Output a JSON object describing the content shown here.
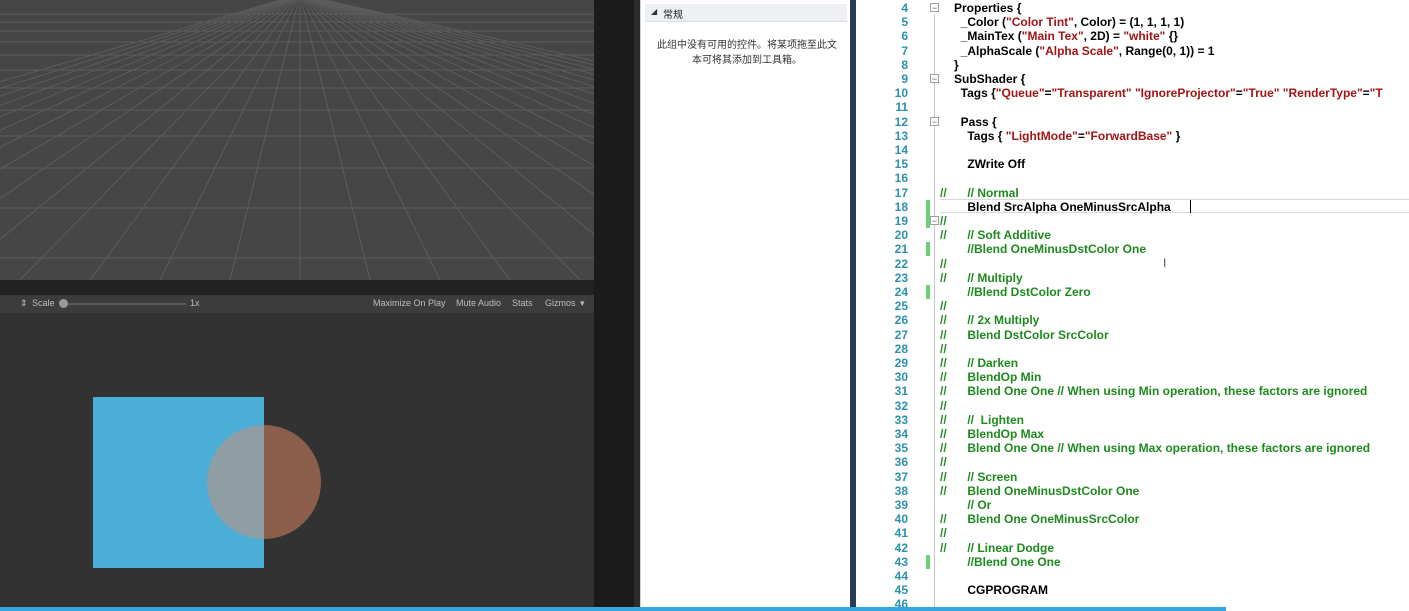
{
  "unity": {
    "game_toolbar": {
      "scale_label": "Scale",
      "scale_value": "1x",
      "maximize_on_play": "Maximize On Play",
      "mute_audio": "Mute Audio",
      "stats": "Stats",
      "gizmos": "Gizmos"
    },
    "colors": {
      "square": "#4aaed6",
      "circle_overlap": "#8f9ea4",
      "circle_bg": "#8b5f4c"
    }
  },
  "toolbox": {
    "header": "常规",
    "message": "此组中没有可用的控件。将某项拖至此文本可将其添加到工具箱。"
  },
  "editor": {
    "lines": [
      {
        "n": "4",
        "pre": "",
        "tokens": [
          {
            "t": "Properties {",
            "c": "b"
          }
        ]
      },
      {
        "n": "5",
        "pre": "",
        "tokens": [
          {
            "t": "  _Color (",
            "c": "b"
          },
          {
            "t": "\"Color Tint\"",
            "c": "r"
          },
          {
            "t": ", Color) = (1, 1, 1, 1)",
            "c": "b"
          }
        ]
      },
      {
        "n": "6",
        "pre": "",
        "tokens": [
          {
            "t": "  _MainTex (",
            "c": "b"
          },
          {
            "t": "\"Main Tex\"",
            "c": "r"
          },
          {
            "t": ", 2D) = ",
            "c": "b"
          },
          {
            "t": "\"white\"",
            "c": "r"
          },
          {
            "t": " {}",
            "c": "b"
          }
        ]
      },
      {
        "n": "7",
        "pre": "",
        "tokens": [
          {
            "t": "  _AlphaScale (",
            "c": "b"
          },
          {
            "t": "\"Alpha Scale\"",
            "c": "r"
          },
          {
            "t": ", Range(0, 1)) = 1",
            "c": "b"
          }
        ]
      },
      {
        "n": "8",
        "pre": "",
        "tokens": [
          {
            "t": "}",
            "c": "b"
          }
        ]
      },
      {
        "n": "9",
        "pre": "",
        "tokens": [
          {
            "t": "SubShader {",
            "c": "b"
          }
        ]
      },
      {
        "n": "10",
        "pre": "",
        "tokens": [
          {
            "t": "  Tags {",
            "c": "b"
          },
          {
            "t": "\"Queue\"",
            "c": "r"
          },
          {
            "t": "=",
            "c": "b"
          },
          {
            "t": "\"Transparent\"",
            "c": "r"
          },
          {
            "t": " ",
            "c": "b"
          },
          {
            "t": "\"IgnoreProjector\"",
            "c": "r"
          },
          {
            "t": "=",
            "c": "b"
          },
          {
            "t": "\"True\"",
            "c": "r"
          },
          {
            "t": " ",
            "c": "b"
          },
          {
            "t": "\"RenderType\"",
            "c": "r"
          },
          {
            "t": "=",
            "c": "b"
          },
          {
            "t": "\"T",
            "c": "r"
          }
        ]
      },
      {
        "n": "11",
        "pre": "",
        "tokens": []
      },
      {
        "n": "12",
        "pre": "",
        "tokens": [
          {
            "t": "  Pass {",
            "c": "b"
          }
        ]
      },
      {
        "n": "13",
        "pre": "",
        "tokens": [
          {
            "t": "    Tags { ",
            "c": "b"
          },
          {
            "t": "\"LightMode\"",
            "c": "r"
          },
          {
            "t": "=",
            "c": "b"
          },
          {
            "t": "\"ForwardBase\"",
            "c": "r"
          },
          {
            "t": " }",
            "c": "b"
          }
        ]
      },
      {
        "n": "14",
        "pre": "",
        "tokens": []
      },
      {
        "n": "15",
        "pre": "",
        "tokens": [
          {
            "t": "    ZWrite Off",
            "c": "b"
          }
        ]
      },
      {
        "n": "16",
        "pre": "",
        "tokens": []
      },
      {
        "n": "17",
        "pre": "//",
        "tokens": [
          {
            "t": "    // Normal",
            "c": "g"
          }
        ]
      },
      {
        "n": "18",
        "pre": "",
        "tokens": [
          {
            "t": "    Blend SrcAlpha OneMinusSrcAlpha",
            "c": "b"
          }
        ]
      },
      {
        "n": "19",
        "pre": "//",
        "tokens": []
      },
      {
        "n": "20",
        "pre": "//",
        "tokens": [
          {
            "t": "    // Soft Additive",
            "c": "g"
          }
        ]
      },
      {
        "n": "21",
        "pre": "",
        "tokens": [
          {
            "t": "    //Blend OneMinusDstColor One",
            "c": "g"
          }
        ]
      },
      {
        "n": "22",
        "pre": "//",
        "tokens": []
      },
      {
        "n": "23",
        "pre": "//",
        "tokens": [
          {
            "t": "    // Multiply",
            "c": "g"
          }
        ]
      },
      {
        "n": "24",
        "pre": "",
        "tokens": [
          {
            "t": "    //Blend DstColor Zero",
            "c": "g"
          }
        ]
      },
      {
        "n": "25",
        "pre": "//",
        "tokens": []
      },
      {
        "n": "26",
        "pre": "//",
        "tokens": [
          {
            "t": "    // 2x Multiply",
            "c": "g"
          }
        ]
      },
      {
        "n": "27",
        "pre": "//",
        "tokens": [
          {
            "t": "    Blend DstColor SrcColor",
            "c": "g"
          }
        ]
      },
      {
        "n": "28",
        "pre": "//",
        "tokens": []
      },
      {
        "n": "29",
        "pre": "//",
        "tokens": [
          {
            "t": "    // Darken",
            "c": "g"
          }
        ]
      },
      {
        "n": "30",
        "pre": "//",
        "tokens": [
          {
            "t": "    BlendOp Min",
            "c": "g"
          }
        ]
      },
      {
        "n": "31",
        "pre": "//",
        "tokens": [
          {
            "t": "    Blend One One // When using Min operation, these factors are ignored",
            "c": "g"
          }
        ]
      },
      {
        "n": "32",
        "pre": "//",
        "tokens": []
      },
      {
        "n": "33",
        "pre": "//",
        "tokens": [
          {
            "t": "    //  Lighten",
            "c": "g"
          }
        ]
      },
      {
        "n": "34",
        "pre": "//",
        "tokens": [
          {
            "t": "    BlendOp Max",
            "c": "g"
          }
        ]
      },
      {
        "n": "35",
        "pre": "//",
        "tokens": [
          {
            "t": "    Blend One One // When using Max operation, these factors are ignored",
            "c": "g"
          }
        ]
      },
      {
        "n": "36",
        "pre": "//",
        "tokens": []
      },
      {
        "n": "37",
        "pre": "//",
        "tokens": [
          {
            "t": "    // Screen",
            "c": "g"
          }
        ]
      },
      {
        "n": "38",
        "pre": "//",
        "tokens": [
          {
            "t": "    Blend OneMinusDstColor One",
            "c": "g"
          }
        ]
      },
      {
        "n": "39",
        "pre": "",
        "tokens": [
          {
            "t": "    // Or",
            "c": "g"
          }
        ]
      },
      {
        "n": "40",
        "pre": "//",
        "tokens": [
          {
            "t": "    Blend One OneMinusSrcColor",
            "c": "g"
          }
        ]
      },
      {
        "n": "41",
        "pre": "//",
        "tokens": []
      },
      {
        "n": "42",
        "pre": "//",
        "tokens": [
          {
            "t": "    // Linear Dodge",
            "c": "g"
          }
        ]
      },
      {
        "n": "43",
        "pre": "",
        "tokens": [
          {
            "t": "    //Blend One One",
            "c": "g"
          }
        ]
      },
      {
        "n": "44",
        "pre": "",
        "tokens": []
      },
      {
        "n": "45",
        "pre": "",
        "tokens": [
          {
            "t": "    CGPROGRAM",
            "c": "b"
          }
        ]
      },
      {
        "n": "46",
        "pre": "",
        "tokens": []
      }
    ]
  }
}
